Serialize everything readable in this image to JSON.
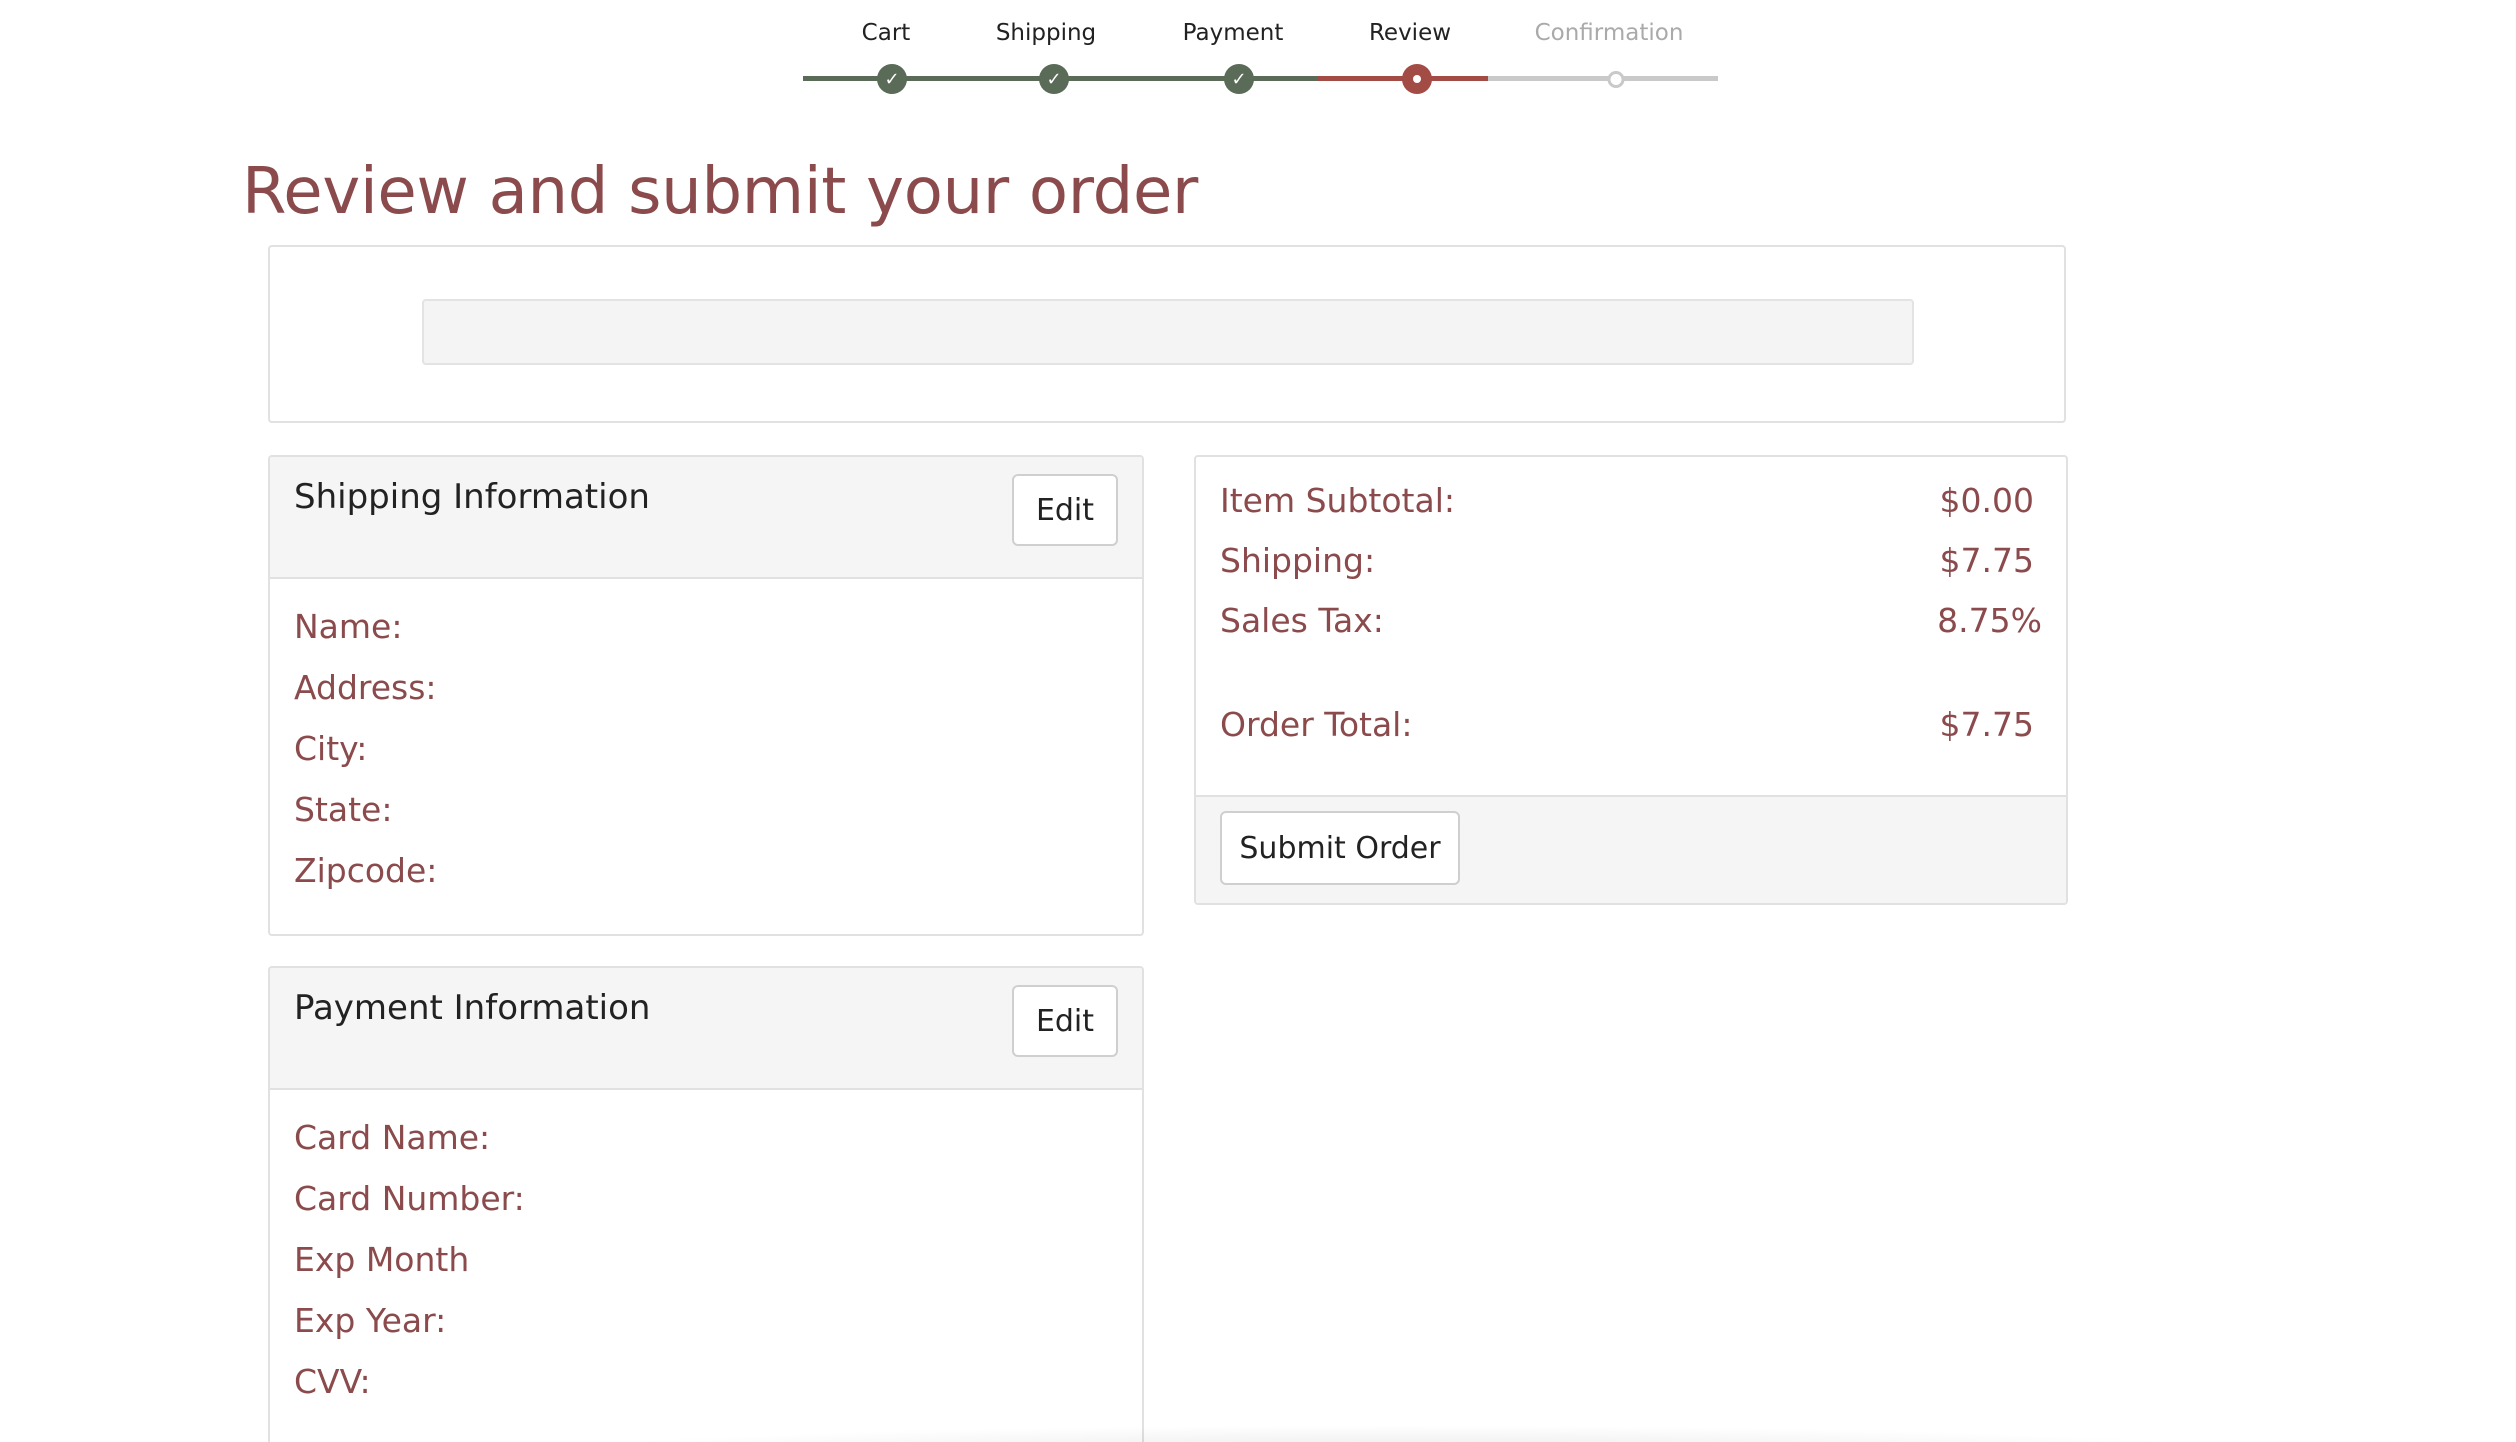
{
  "stepper": {
    "steps": [
      {
        "label": "Cart",
        "state": "done"
      },
      {
        "label": "Shipping",
        "state": "done"
      },
      {
        "label": "Payment",
        "state": "done"
      },
      {
        "label": "Review",
        "state": "active"
      },
      {
        "label": "Confirmation",
        "state": "todo"
      }
    ]
  },
  "page": {
    "title": "Review and submit your order"
  },
  "shipping": {
    "title": "Shipping Information",
    "edit_label": "Edit",
    "fields": [
      "Name:",
      "Address:",
      "City:",
      "State:",
      "Zipcode:"
    ]
  },
  "payment": {
    "title": "Payment Information",
    "edit_label": "Edit",
    "fields": [
      "Card Name:",
      "Card Number:",
      "Exp Month",
      "Exp Year:",
      "CVV:"
    ]
  },
  "summary": {
    "rows": [
      {
        "label": "Item Subtotal:",
        "value": "$0.00"
      },
      {
        "label": "Shipping:",
        "value": "$7.75"
      },
      {
        "label": "Sales Tax:",
        "value": "8.75%"
      },
      {
        "label": "Order Total:",
        "value": "$7.75"
      }
    ],
    "submit_label": "Submit Order"
  },
  "colors": {
    "accent": "#8b4a4c",
    "step_done": "#5a6b57",
    "step_active": "#a34b45",
    "step_todo": "#c9c9c9"
  }
}
